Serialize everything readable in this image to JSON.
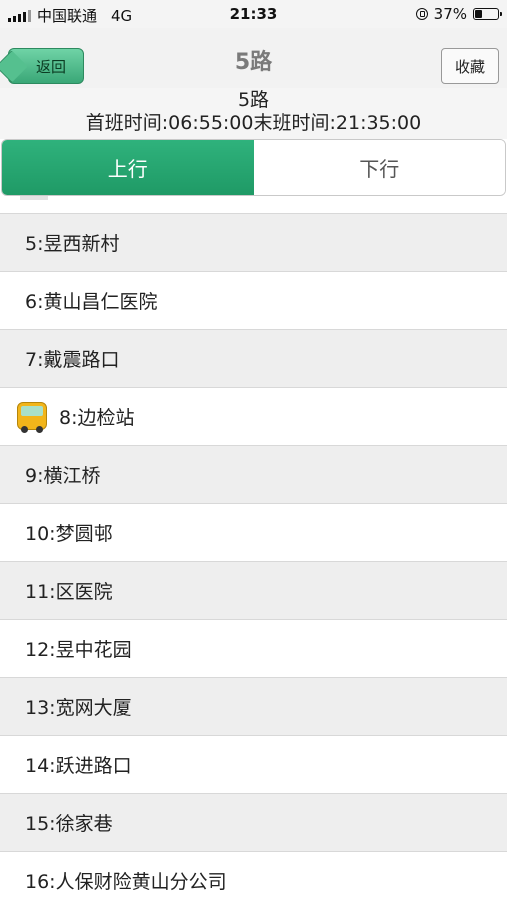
{
  "status_bar": {
    "carrier": "中国联通",
    "network": "4G",
    "time": "21:33",
    "battery": "37%",
    "battery_level": 0.37
  },
  "nav": {
    "back_label": "返回",
    "title": "5路",
    "favorite_label": "收藏"
  },
  "route": {
    "name": "5路",
    "schedule": "首班时间:06:55:00末班时间:21:35:00"
  },
  "direction_toggle": {
    "up_label": "上行",
    "down_label": "下行",
    "selected": "上行"
  },
  "colors": {
    "accent_green": "#22a36e",
    "bus_yellow": "#f2b51a"
  },
  "stops": [
    {
      "label": "5:昱西新村"
    },
    {
      "label": "6:黄山昌仁医院"
    },
    {
      "label": "7:戴震路口"
    },
    {
      "label": "8:边检站",
      "bus_here": true
    },
    {
      "label": "9:横江桥"
    },
    {
      "label": "10:梦圆邨"
    },
    {
      "label": "11:区医院"
    },
    {
      "label": "12:昱中花园"
    },
    {
      "label": "13:宽网大厦"
    },
    {
      "label": "14:跃进路口"
    },
    {
      "label": "15:徐家巷"
    },
    {
      "label": "16:人保财险黄山分公司"
    }
  ]
}
